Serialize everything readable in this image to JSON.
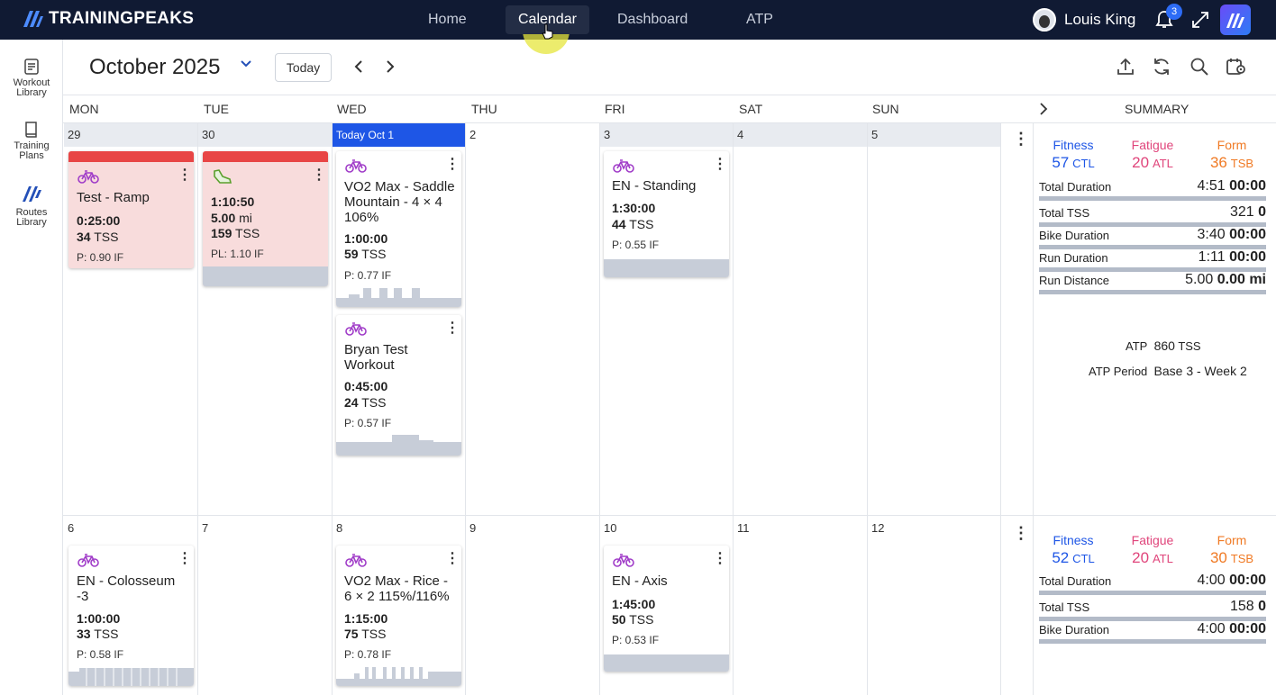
{
  "app": {
    "brand": "TRAININGPEAKS"
  },
  "nav": [
    "Home",
    "Calendar",
    "Dashboard",
    "ATP"
  ],
  "user": {
    "name": "Louis King",
    "notifications": "3"
  },
  "sidebar": [
    {
      "label1": "Workout",
      "label2": "Library"
    },
    {
      "label1": "Training",
      "label2": "Plans"
    },
    {
      "label1": "Routes",
      "label2": "Library"
    }
  ],
  "header": {
    "month": "October 2025",
    "today_label": "Today"
  },
  "days": [
    "MON",
    "TUE",
    "WED",
    "THU",
    "FRI",
    "SAT",
    "SUN"
  ],
  "summary_label": "SUMMARY",
  "week1": {
    "dates": [
      "29",
      "30",
      "Today Oct 1",
      "2",
      "3",
      "4",
      "5"
    ],
    "cards": [
      {
        "title": "Test - Ramp",
        "dur": "0:25:00",
        "tss": "34",
        "tss_u": "TSS",
        "if": "P: 0.90 IF"
      },
      {
        "dur": "1:10:50",
        "dist": "5.00",
        "dist_u": "mi",
        "tss": "159",
        "tss_u": "TSS",
        "if": "PL: 1.10 IF"
      },
      {
        "title": "VO2 Max - Saddle Mountain - 4 × 4 106%",
        "dur": "1:00:00",
        "tss": "59",
        "tss_u": "TSS",
        "if": "P: 0.77 IF"
      },
      {
        "title": "Bryan Test Workout",
        "dur": "0:45:00",
        "tss": "24",
        "tss_u": "TSS",
        "if": "P: 0.57 IF"
      },
      {
        "title": "EN - Standing",
        "dur": "1:30:00",
        "tss": "44",
        "tss_u": "TSS",
        "if": "P: 0.55 IF"
      }
    ],
    "summary": {
      "fitness": {
        "label": "Fitness",
        "value": "57",
        "unit": "CTL"
      },
      "fatigue": {
        "label": "Fatigue",
        "value": "20",
        "unit": "ATL"
      },
      "form": {
        "label": "Form",
        "value": "36",
        "unit": "TSB"
      },
      "rows": [
        {
          "label": "Total Duration",
          "a": "4:51",
          "b": "00:00"
        },
        {
          "label": "Total TSS",
          "a": "321",
          "b": "0"
        },
        {
          "label": "Bike Duration",
          "a": "3:40",
          "b": "00:00"
        },
        {
          "label": "Run Duration",
          "a": "1:11",
          "b": "00:00"
        },
        {
          "label": "Run Distance",
          "a": "5.00",
          "b": "0.00 mi"
        }
      ],
      "atp_label": "ATP",
      "atp_value": "860",
      "atp_unit": "TSS",
      "period_label": "ATP Period",
      "period_value": "Base 3 - Week 2"
    }
  },
  "week2": {
    "dates": [
      "6",
      "7",
      "8",
      "9",
      "10",
      "11",
      "12"
    ],
    "cards": [
      {
        "title": "EN - Colosseum -3",
        "dur": "1:00:00",
        "tss": "33",
        "tss_u": "TSS",
        "if": "P: 0.58 IF"
      },
      {
        "title": "VO2 Max - Rice - 6 × 2 115%/116%",
        "dur": "1:15:00",
        "tss": "75",
        "tss_u": "TSS",
        "if": "P: 0.78 IF"
      },
      {
        "title": "EN - Axis",
        "dur": "1:45:00",
        "tss": "50",
        "tss_u": "TSS",
        "if": "P: 0.53 IF"
      }
    ],
    "summary": {
      "fitness": {
        "label": "Fitness",
        "value": "52",
        "unit": "CTL"
      },
      "fatigue": {
        "label": "Fatigue",
        "value": "20",
        "unit": "ATL"
      },
      "form": {
        "label": "Form",
        "value": "30",
        "unit": "TSB"
      },
      "rows": [
        {
          "label": "Total Duration",
          "a": "4:00",
          "b": "00:00"
        },
        {
          "label": "Total TSS",
          "a": "158",
          "b": "0"
        },
        {
          "label": "Bike Duration",
          "a": "4:00",
          "b": "00:00"
        }
      ]
    }
  },
  "colors": {
    "topbar": "#101a33",
    "today": "#1e56e6",
    "missed": "#e84545",
    "fitness": "#1e56e6",
    "fatigue": "#e0457b",
    "form": "#f07a24",
    "bike": "#a03cc8",
    "run": "#5aa02c"
  }
}
